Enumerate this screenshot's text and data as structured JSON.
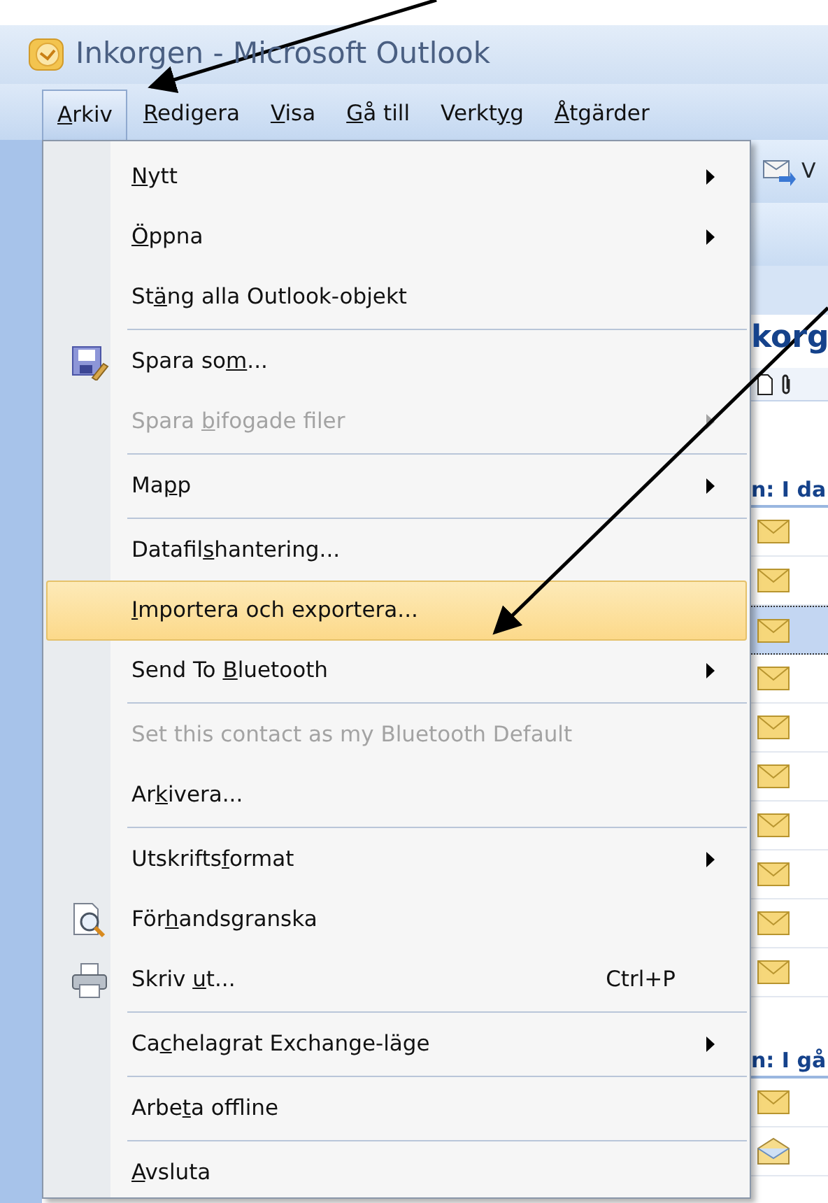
{
  "window": {
    "title": "Inkorgen - Microsoft Outlook"
  },
  "menubar": [
    {
      "key": "A",
      "after": "rkiv",
      "selected": true
    },
    {
      "key": "R",
      "after": "edigera",
      "selected": false
    },
    {
      "key": "V",
      "after": "isa",
      "selected": false
    },
    {
      "key": "G",
      "after": "å till",
      "selected": false
    },
    {
      "before": "Verkt",
      "key": "y",
      "after": "g",
      "selected": false
    },
    {
      "key": "Å",
      "after": "tgärder",
      "selected": false
    }
  ],
  "menu": [
    {
      "kind": "command",
      "key": "N",
      "after": "ytt",
      "submenu": true,
      "disabled": false,
      "selected": false
    },
    {
      "kind": "command",
      "key": "Ö",
      "after": "ppna",
      "submenu": true,
      "disabled": false,
      "selected": false
    },
    {
      "kind": "command",
      "before": "St",
      "key": "ä",
      "after": "ng alla Outlook-objekt",
      "submenu": false,
      "disabled": false,
      "selected": false
    },
    {
      "kind": "separator"
    },
    {
      "kind": "saveas",
      "before": "Spara so",
      "key": "m",
      "after": "...",
      "submenu": false,
      "disabled": false,
      "selected": false
    },
    {
      "kind": "command",
      "before": "Spara ",
      "key": "b",
      "after": "ifogade filer",
      "submenu": true,
      "disabled": true,
      "selected": false
    },
    {
      "kind": "separator"
    },
    {
      "kind": "command",
      "before": "Ma",
      "key": "p",
      "after": "p",
      "submenu": true,
      "disabled": false,
      "selected": false
    },
    {
      "kind": "separator"
    },
    {
      "kind": "command",
      "before": "Datafil",
      "key": "s",
      "after": "hantering...",
      "submenu": false,
      "disabled": false,
      "selected": false
    },
    {
      "kind": "command",
      "key": "I",
      "after": "mportera och exportera...",
      "submenu": false,
      "disabled": false,
      "selected": true
    },
    {
      "kind": "command",
      "before": "Send To ",
      "key": "B",
      "after": "luetooth",
      "submenu": true,
      "disabled": false,
      "selected": false
    },
    {
      "kind": "separator"
    },
    {
      "kind": "command",
      "before": "Set this contact as my Bluetooth Default",
      "submenu": false,
      "disabled": true,
      "selected": false
    },
    {
      "kind": "command",
      "before": "Ar",
      "key": "k",
      "after": "ivera...",
      "submenu": false,
      "disabled": false,
      "selected": false
    },
    {
      "kind": "separator"
    },
    {
      "kind": "command",
      "before": "Utskrifts",
      "key": "f",
      "after": "ormat",
      "submenu": true,
      "disabled": false,
      "selected": false
    },
    {
      "kind": "preview",
      "before": "För",
      "key": "h",
      "after": "andsgranska",
      "submenu": false,
      "disabled": false,
      "selected": false
    },
    {
      "kind": "print",
      "before": "Skriv ",
      "key": "u",
      "after": "t...",
      "shortcut": "Ctrl+P",
      "submenu": false,
      "disabled": false,
      "selected": false
    },
    {
      "kind": "separator"
    },
    {
      "kind": "command",
      "before": "Ca",
      "key": "c",
      "after": "helagrat Exchange-läge",
      "submenu": true,
      "disabled": false,
      "selected": false
    },
    {
      "kind": "separator"
    },
    {
      "kind": "command",
      "before": "Arbe",
      "key": "t",
      "after": "a offline",
      "submenu": false,
      "disabled": false,
      "selected": false
    },
    {
      "kind": "separator"
    },
    {
      "kind": "command",
      "key": "A",
      "after": "vsluta",
      "submenu": false,
      "disabled": false,
      "selected": false
    }
  ],
  "toolbar": {
    "button": "V"
  },
  "pane": [
    {
      "kind": "heading",
      "text": "korg"
    },
    {
      "kind": "columns"
    },
    {
      "kind": "group",
      "text": "n: I da"
    },
    {
      "kind": "message",
      "read": false,
      "selected": false
    },
    {
      "kind": "message",
      "read": false,
      "selected": false
    },
    {
      "kind": "message",
      "read": false,
      "selected": true
    },
    {
      "kind": "message",
      "read": false,
      "selected": false
    },
    {
      "kind": "message",
      "read": false,
      "selected": false
    },
    {
      "kind": "message",
      "read": false,
      "selected": false
    },
    {
      "kind": "message",
      "read": false,
      "selected": false
    },
    {
      "kind": "message",
      "read": false,
      "selected": false
    },
    {
      "kind": "message",
      "read": false,
      "selected": false
    },
    {
      "kind": "message",
      "read": false,
      "selected": false
    },
    {
      "kind": "group",
      "text": "n: I gå"
    },
    {
      "kind": "message",
      "read": false,
      "selected": false
    },
    {
      "kind": "message",
      "read": true,
      "selected": false
    }
  ]
}
